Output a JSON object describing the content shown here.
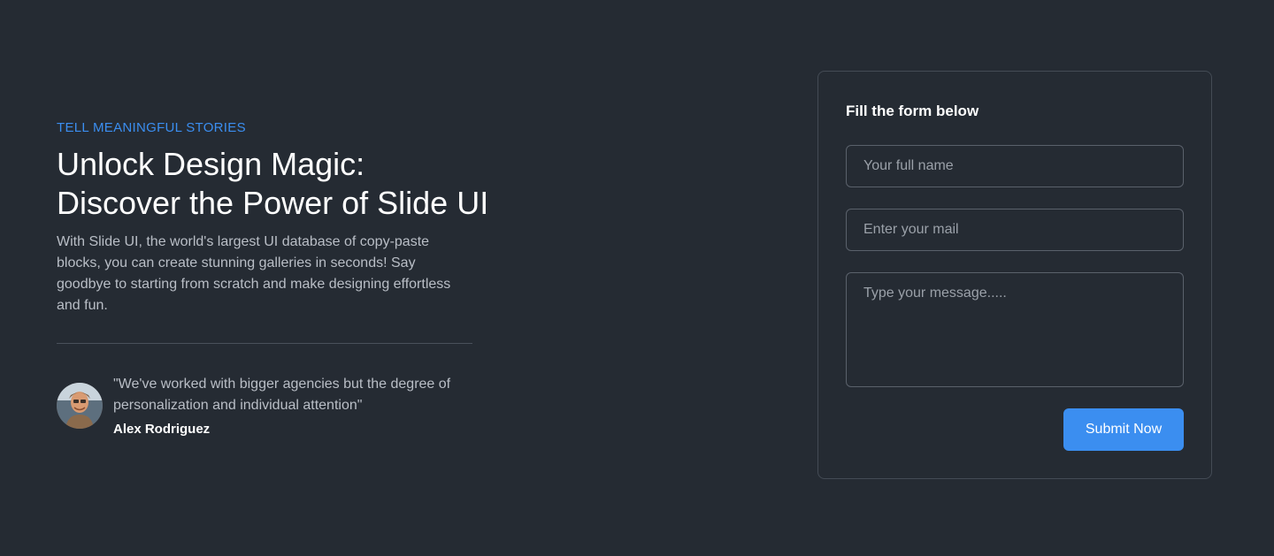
{
  "hero": {
    "eyebrow": "TELL MEANINGFUL STORIES",
    "headline_line1": "Unlock Design Magic:",
    "headline_line2": "Discover the Power of Slide UI",
    "description": "With Slide UI, the world's largest UI database of copy-paste blocks, you can create stunning galleries in seconds! Say goodbye to starting from scratch and make designing effortless and fun."
  },
  "testimonial": {
    "quote": "\"We've worked with bigger agencies but the degree of personalization and individual attention\"",
    "author": "Alex Rodriguez"
  },
  "form": {
    "title": "Fill the form below",
    "name_placeholder": "Your full name",
    "mail_placeholder": "Enter your mail",
    "message_placeholder": "Type your message.....",
    "submit_label": "Submit Now"
  },
  "colors": {
    "background": "#252b33",
    "accent": "#3b8ef0",
    "border": "#444b55"
  }
}
